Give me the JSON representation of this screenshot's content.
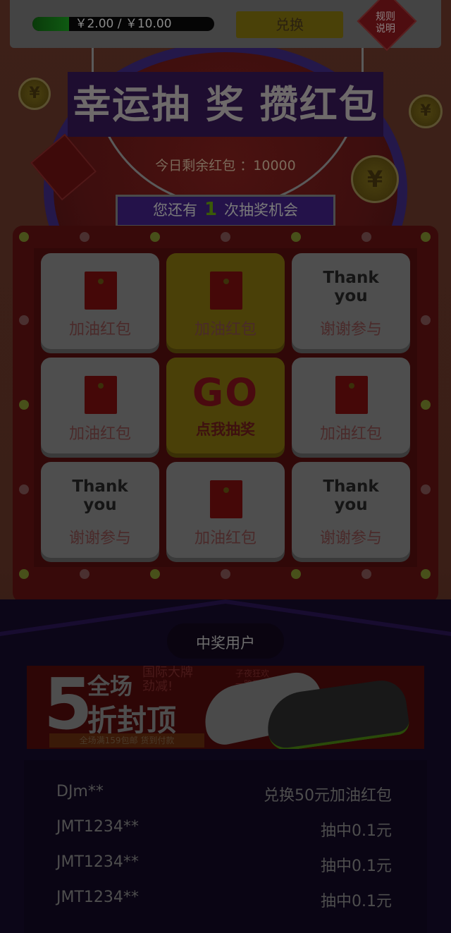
{
  "top_bar": {
    "balance_text": "￥2.00 / ￥10.00",
    "progress": 0.2,
    "redeem_label": "兑换",
    "rules_label": "规则\n说明"
  },
  "header": {
    "title": "幸运抽 奖 攒红包",
    "remaining_text": "今日剩余红包 ：10000",
    "chance_prefix": "您还有",
    "chance_count": "1",
    "chance_suffix": "次抽奖机会"
  },
  "coin_symbol": "¥",
  "grid": {
    "cells": [
      {
        "kind": "envelope",
        "label": "加油红包",
        "active": false
      },
      {
        "kind": "envelope",
        "label": "加油红包",
        "active": true
      },
      {
        "kind": "thanks",
        "title": "Thank you",
        "label": "谢谢参与",
        "active": false
      },
      {
        "kind": "envelope",
        "label": "加油红包",
        "active": false
      },
      {
        "kind": "go",
        "title": "GO",
        "label": "点我抽奖",
        "active": true
      },
      {
        "kind": "envelope",
        "label": "加油红包",
        "active": false
      },
      {
        "kind": "thanks",
        "title": "Thank you",
        "label": "谢谢参与",
        "active": false
      },
      {
        "kind": "envelope",
        "label": "加油红包",
        "active": false
      },
      {
        "kind": "thanks",
        "title": "Thank you",
        "label": "谢谢参与",
        "active": false
      }
    ]
  },
  "winners": {
    "title": "中奖用户",
    "ad": {
      "big_number": "5",
      "line1": "全场",
      "line2": "折封顶",
      "line3": "国际大牌\n劲减!",
      "strip": "全场满159包邮 货到付款",
      "stamp": "子夜狂欢\n一路狂跌"
    },
    "list": [
      {
        "user": "DJm**",
        "prize": "兑换50元加油红包"
      },
      {
        "user": "JMT1234**",
        "prize": "抽中0.1元"
      },
      {
        "user": "JMT1234**",
        "prize": "抽中0.1元"
      },
      {
        "user": "JMT1234**",
        "prize": "抽中0.1元"
      }
    ]
  }
}
